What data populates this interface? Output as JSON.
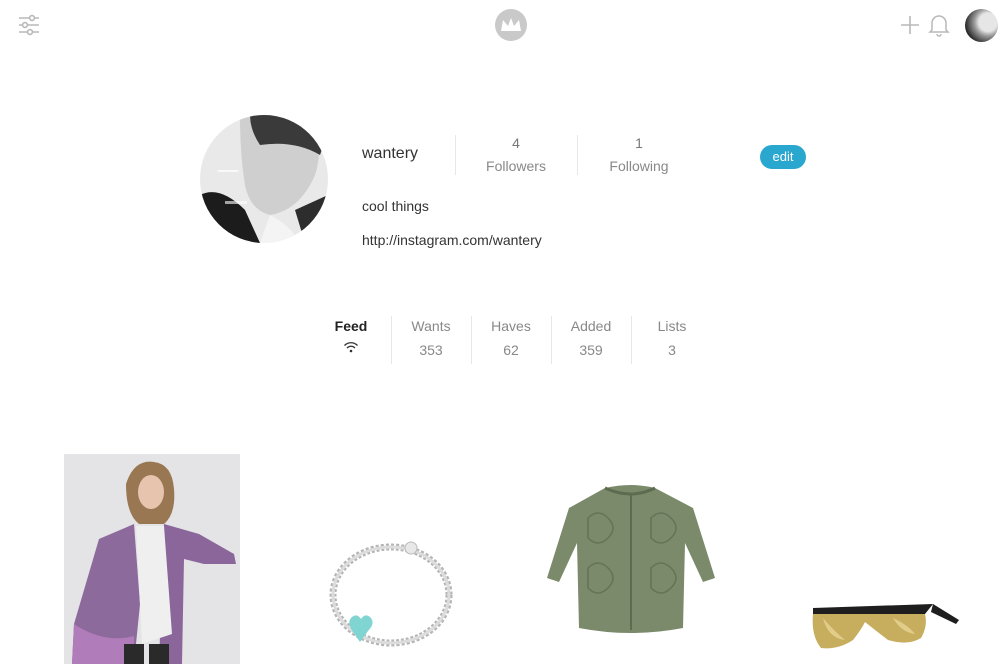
{
  "topbar": {
    "icons": [
      "filter-sliders-icon",
      "crown-logo-icon",
      "plus-icon",
      "bell-icon"
    ]
  },
  "profile": {
    "username": "wantery",
    "followers_count": "4",
    "followers_label": "Followers",
    "following_count": "1",
    "following_label": "Following",
    "edit_label": "edit",
    "bio": "cool things",
    "website": "http://instagram.com/wantery"
  },
  "tabs": [
    {
      "label": "Feed",
      "icon": "wifi-icon",
      "active": true
    },
    {
      "label": "Wants",
      "count": "353"
    },
    {
      "label": "Haves",
      "count": "62"
    },
    {
      "label": "Added",
      "count": "359"
    },
    {
      "label": "Lists",
      "count": "3"
    }
  ],
  "feed": {
    "items": [
      "purple-raincoat",
      "heart-tag-bracelet",
      "quilted-green-jacket",
      "gold-mirrored-sunglasses"
    ]
  },
  "colors": {
    "accent": "#2aa7cf",
    "icon_gray": "#b8b8b8",
    "text_gray": "#888888"
  }
}
